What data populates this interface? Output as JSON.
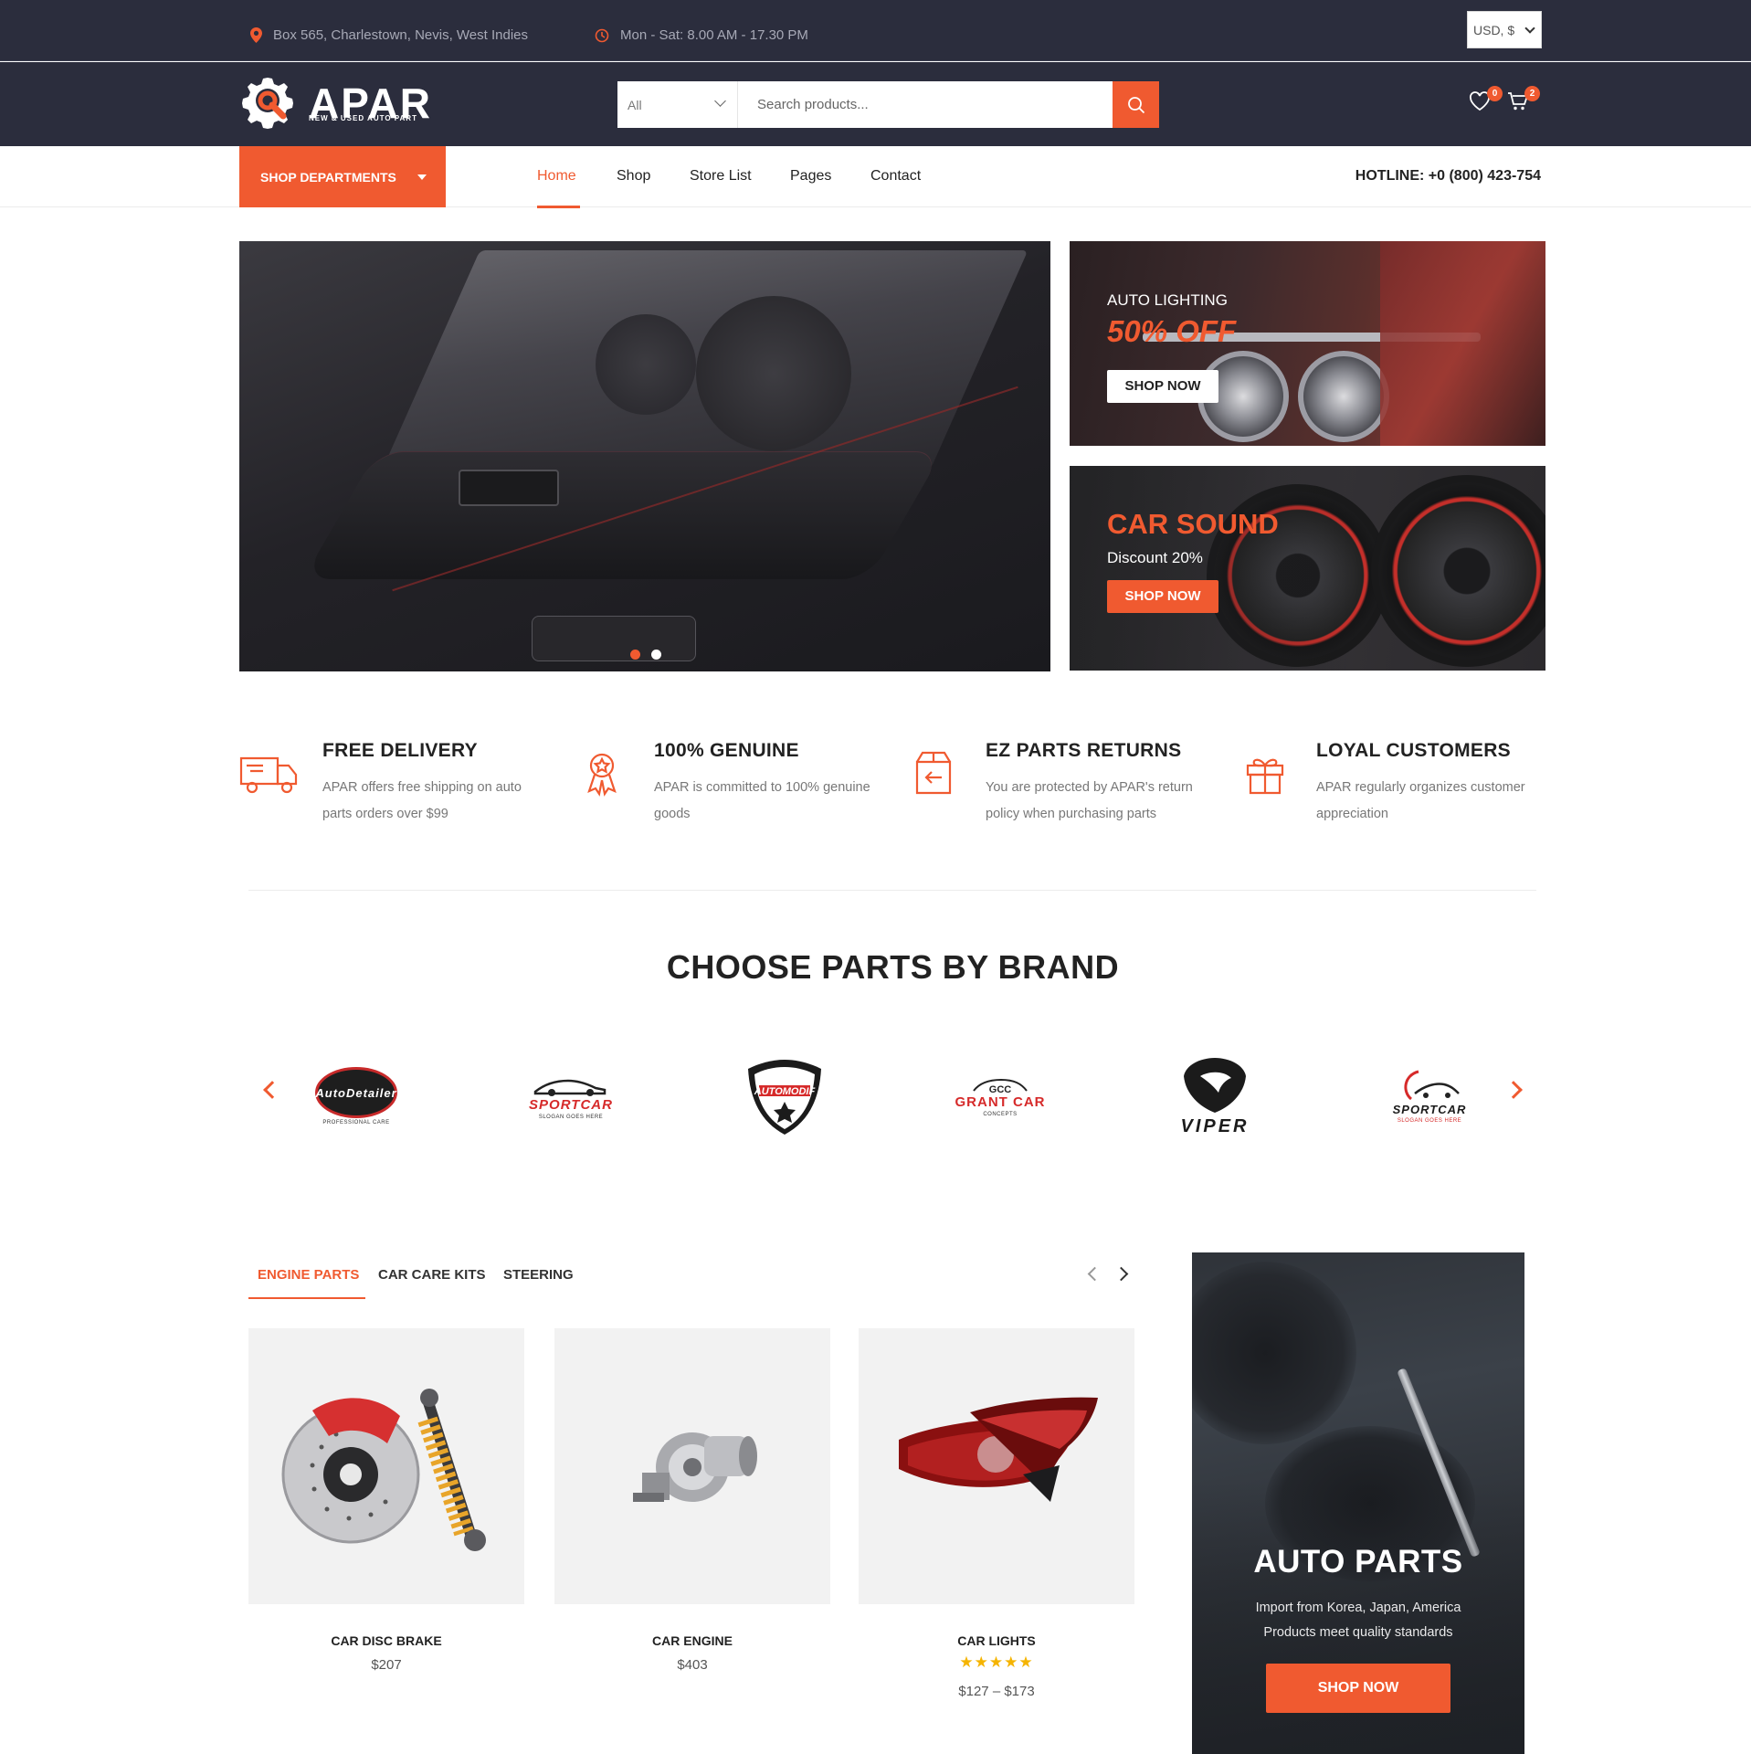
{
  "topbar": {
    "address": "Box 565, Charlestown, Nevis, West Indies",
    "hours": "Mon - Sat: 8.00 AM - 17.30 PM",
    "currency": "USD, $"
  },
  "header": {
    "logo_text": "APAR",
    "logo_tagline": "NEW & USED AUTO PART",
    "search_category": "All",
    "search_placeholder": "Search products...",
    "wishlist_count": "0",
    "cart_count": "2"
  },
  "nav": {
    "shop_departments": "SHOP DEPARTMENTS",
    "links": [
      "Home",
      "Shop",
      "Store List",
      "Pages",
      "Contact"
    ],
    "hotline": "HOTLINE: +0 (800) 423-754"
  },
  "promos": {
    "p1_label": "AUTO LIGHTING",
    "p1_big": "50% OFF",
    "p1_button": "SHOP NOW",
    "p2_big": "CAR SOUND",
    "p2_label": "Discount 20%",
    "p2_button": "SHOP NOW"
  },
  "features": [
    {
      "title": "FREE DELIVERY",
      "desc": "APAR offers free shipping on auto parts orders over $99"
    },
    {
      "title": "100% GENUINE",
      "desc": "APAR is committed to 100% genuine goods"
    },
    {
      "title": "EZ PARTS RETURNS",
      "desc": "You are protected by APAR's return policy when purchasing parts"
    },
    {
      "title": "LOYAL CUSTOMERS",
      "desc": "APAR regularly organizes customer appreciation"
    }
  ],
  "brands_section": {
    "title": "CHOOSE PARTS BY BRAND",
    "brands": [
      {
        "name": "AutoDetailer",
        "sub": "PROFESSIONAL CARE"
      },
      {
        "name": "SPORTCAR",
        "sub": "SLOGAN GOES HERE"
      },
      {
        "name": "AUTOMODIF",
        "sub": ""
      },
      {
        "name": "GRANT CAR",
        "sub": "CONCEPTS"
      },
      {
        "name": "VIPER",
        "sub": ""
      },
      {
        "name": "SPORTCAR",
        "sub": "SLOGAN GOES HERE"
      }
    ]
  },
  "products": {
    "tabs": [
      "ENGINE PARTS",
      "CAR CARE KITS",
      "STEERING"
    ],
    "items": [
      {
        "name": "CAR DISC BRAKE",
        "price": "$207"
      },
      {
        "name": "CAR ENGINE",
        "price": "$403"
      },
      {
        "name": "CAR LIGHTS",
        "price": "$127 – $173",
        "stars": "★★★★★"
      }
    ]
  },
  "side_banner": {
    "title": "AUTO PARTS",
    "line1": "Import from Korea, Japan, America",
    "line2": "Products meet quality standards",
    "button": "SHOP NOW"
  },
  "colors": {
    "accent": "#f05a30",
    "dark": "#2b2d3d"
  }
}
